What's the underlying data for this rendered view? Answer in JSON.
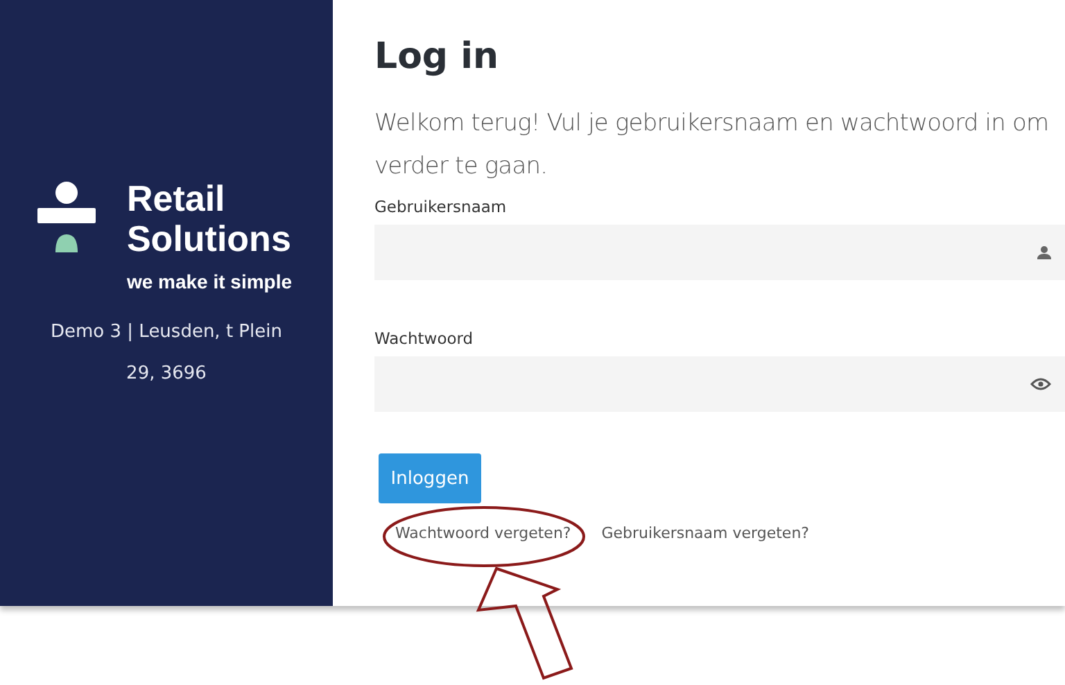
{
  "sidebar": {
    "brand": {
      "name_line_1": "Retail",
      "name_line_2": "Solutions",
      "tagline": "we make it simple"
    },
    "location": "Demo 3 | Leusden, t Plein 29, 3696"
  },
  "login": {
    "title": "Log in",
    "intro": "Welkom terug! Vul je gebruikersnaam en wachtwoord in om verder te gaan.",
    "fields": [
      {
        "label": "Gebruikersnaam",
        "kind": "user"
      },
      {
        "label": "Wachtwoord",
        "kind": "password"
      }
    ],
    "button": "Inloggen",
    "links": [
      {
        "label": "Wachtwoord vergeten?",
        "highlighted": true
      },
      {
        "label": "Gebruikersnaam vergeten?",
        "highlighted": false
      }
    ]
  }
}
